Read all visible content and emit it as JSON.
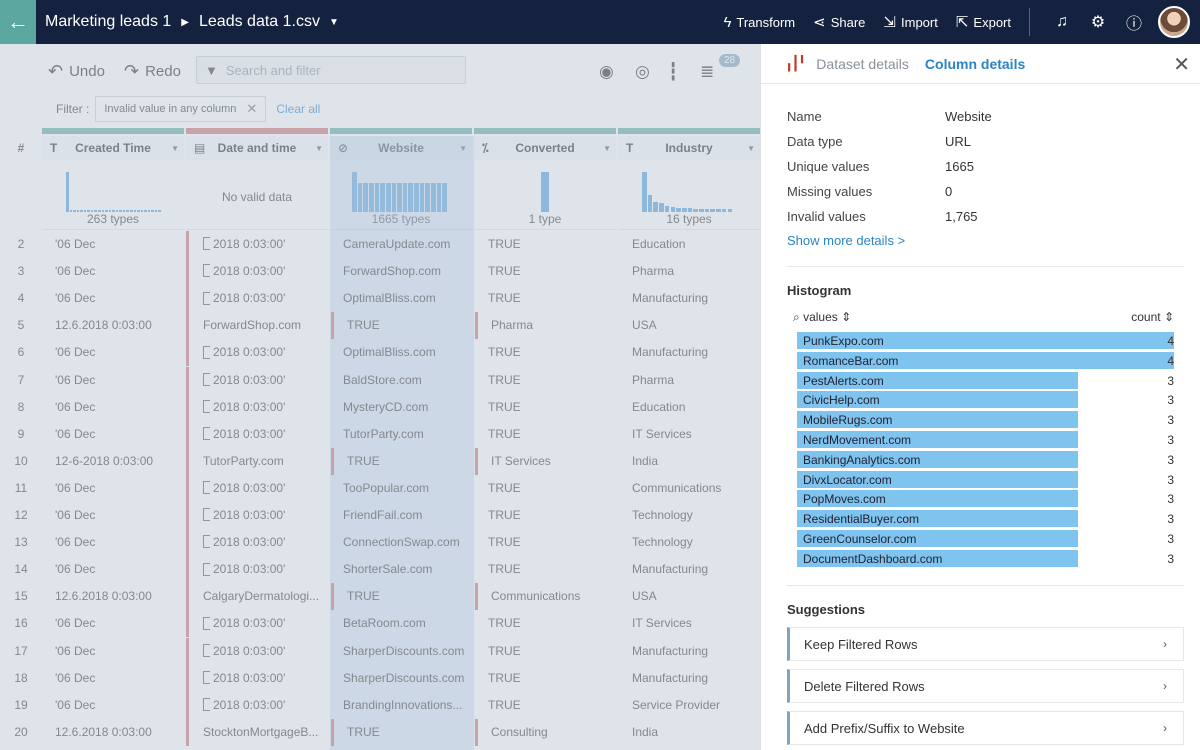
{
  "topbar": {
    "back_icon": "arrow-left-icon",
    "project": "Marketing leads 1",
    "dataset": "Leads data 1.csv",
    "actions": [
      {
        "icon": "bolt-icon",
        "label": "Transform"
      },
      {
        "icon": "share-icon",
        "label": "Share"
      },
      {
        "icon": "import-icon",
        "label": "Import"
      },
      {
        "icon": "export-icon",
        "label": "Export"
      }
    ],
    "icons": [
      "bell-icon",
      "gear-icon",
      "help-icon"
    ]
  },
  "toolbar": {
    "undo": "Undo",
    "redo": "Redo",
    "search_placeholder": "Search and filter",
    "badge": "28"
  },
  "filter": {
    "label": "Filter :",
    "chip": "Invalid value in any column",
    "clear": "Clear all"
  },
  "columns": [
    {
      "type_icon": "T",
      "name": "Created Time",
      "hist_caption": "263 types",
      "bars": [
        0.95,
        0.05,
        0.05,
        0.05,
        0.05,
        0.05,
        0.05,
        0.05,
        0.05,
        0.05,
        0.05,
        0.05,
        0.05,
        0.05,
        0.05,
        0.05,
        0.05,
        0.05,
        0.05,
        0.05,
        0.05,
        0.05,
        0.05,
        0.05,
        0.05,
        0.05,
        0.05
      ],
      "color": "#5ca7a0"
    },
    {
      "type_icon": "▤",
      "name": "Date and time",
      "hist_caption": "",
      "nodata": "No valid data",
      "bars": [],
      "color": "#c9706f"
    },
    {
      "type_icon": "⊘",
      "name": "Website",
      "hist_caption": "1665 types",
      "bars": [
        0.95,
        0.7,
        0.7,
        0.7,
        0.7,
        0.7,
        0.7,
        0.7,
        0.7,
        0.7,
        0.7,
        0.7,
        0.7,
        0.7,
        0.7,
        0.7,
        0.7
      ],
      "color": "#5ca7a0"
    },
    {
      "type_icon": "⁒",
      "name": "Converted",
      "hist_caption": "1 type",
      "bars": [
        0.95
      ],
      "color": "#5ca7a0"
    },
    {
      "type_icon": "T",
      "name": "Industry",
      "hist_caption": "16 types",
      "bars": [
        0.95,
        0.4,
        0.25,
        0.22,
        0.15,
        0.12,
        0.1,
        0.1,
        0.1,
        0.08,
        0.08,
        0.08,
        0.08,
        0.08,
        0.08,
        0.08
      ],
      "color": "#5ca7a0"
    }
  ],
  "rows": [
    {
      "n": "2",
      "c1": "'06 Dec",
      "c2": "2018 0:03:00'",
      "c2_tick": true,
      "c3": "CameraUpdate.com",
      "c4": "TRUE",
      "c5": "Education",
      "bad": false
    },
    {
      "n": "3",
      "c1": "'06 Dec",
      "c2": "2018 0:03:00'",
      "c2_tick": true,
      "c3": "ForwardShop.com",
      "c4": "TRUE",
      "c5": "Pharma",
      "bad": false
    },
    {
      "n": "4",
      "c1": "'06 Dec",
      "c2": "2018 0:03:00'",
      "c2_tick": true,
      "c3": "OptimalBliss.com",
      "c4": "TRUE",
      "c5": "Manufacturing",
      "bad": false
    },
    {
      "n": "5",
      "c1": "12.6.2018 0:03:00",
      "c2": "ForwardShop.com",
      "c2_tick": false,
      "c3": "TRUE",
      "c4": "Pharma",
      "c5": "USA",
      "bad": true
    },
    {
      "n": "6",
      "c1": "'06 Dec",
      "c2": "2018 0:03:00'",
      "c2_tick": true,
      "c3": "OptimalBliss.com",
      "c4": "TRUE",
      "c5": "Manufacturing",
      "bad": false
    },
    {
      "n": "7",
      "c1": "'06 Dec",
      "c2": "2018 0:03:00'",
      "c2_tick": true,
      "c3": "BaldStore.com",
      "c4": "TRUE",
      "c5": "Pharma",
      "bad": false
    },
    {
      "n": "8",
      "c1": "'06 Dec",
      "c2": "2018 0:03:00'",
      "c2_tick": true,
      "c3": "MysteryCD.com",
      "c4": "TRUE",
      "c5": "Education",
      "bad": false
    },
    {
      "n": "9",
      "c1": "'06 Dec",
      "c2": "2018 0:03:00'",
      "c2_tick": true,
      "c3": "TutorParty.com",
      "c4": "TRUE",
      "c5": "IT Services",
      "bad": false
    },
    {
      "n": "10",
      "c1": "12-6-2018 0:03:00",
      "c2": "TutorParty.com",
      "c2_tick": false,
      "c3": "TRUE",
      "c4": "IT Services",
      "c5": "India",
      "bad": true
    },
    {
      "n": "11",
      "c1": "'06 Dec",
      "c2": "2018 0:03:00'",
      "c2_tick": true,
      "c3": "TooPopular.com",
      "c4": "TRUE",
      "c5": "Communications",
      "bad": false
    },
    {
      "n": "12",
      "c1": "'06 Dec",
      "c2": "2018 0:03:00'",
      "c2_tick": true,
      "c3": "FriendFail.com",
      "c4": "TRUE",
      "c5": "Technology",
      "bad": false
    },
    {
      "n": "13",
      "c1": "'06 Dec",
      "c2": "2018 0:03:00'",
      "c2_tick": true,
      "c3": "ConnectionSwap.com",
      "c4": "TRUE",
      "c5": "Technology",
      "bad": false
    },
    {
      "n": "14",
      "c1": "'06 Dec",
      "c2": "2018 0:03:00'",
      "c2_tick": true,
      "c3": "ShorterSale.com",
      "c4": "TRUE",
      "c5": "Manufacturing",
      "bad": false
    },
    {
      "n": "15",
      "c1": "12.6.2018 0:03:00",
      "c2": "CalgaryDermatologi...",
      "c2_tick": false,
      "c3": "TRUE",
      "c4": "Communications",
      "c5": "USA",
      "bad": true
    },
    {
      "n": "16",
      "c1": "'06 Dec",
      "c2": "2018 0:03:00'",
      "c2_tick": true,
      "c3": "BetaRoom.com",
      "c4": "TRUE",
      "c5": "IT Services",
      "bad": false
    },
    {
      "n": "17",
      "c1": "'06 Dec",
      "c2": "2018 0:03:00'",
      "c2_tick": true,
      "c3": "SharperDiscounts.com",
      "c4": "TRUE",
      "c5": "Manufacturing",
      "bad": false
    },
    {
      "n": "18",
      "c1": "'06 Dec",
      "c2": "2018 0:03:00'",
      "c2_tick": true,
      "c3": "SharperDiscounts.com",
      "c4": "TRUE",
      "c5": "Manufacturing",
      "bad": false
    },
    {
      "n": "19",
      "c1": "'06 Dec",
      "c2": "2018 0:03:00'",
      "c2_tick": true,
      "c3": "BrandingInnovations...",
      "c4": "TRUE",
      "c5": "Service Provider",
      "bad": false
    },
    {
      "n": "20",
      "c1": "12.6.2018 0:03:00",
      "c2": "StocktonMortgageB...",
      "c2_tick": false,
      "c3": "TRUE",
      "c4": "Consulting",
      "c5": "India",
      "bad": true
    }
  ],
  "row_header": "#",
  "panel": {
    "tab_dataset": "Dataset details",
    "tab_column": "Column details",
    "details": [
      {
        "k": "Name",
        "v": "Website"
      },
      {
        "k": "Data type",
        "v": "URL"
      },
      {
        "k": "Unique values",
        "v": "1665"
      },
      {
        "k": "Missing values",
        "v": "0"
      },
      {
        "k": "Invalid values",
        "v": "1,765"
      }
    ],
    "show_more": "Show more details >",
    "histogram_title": "Histogram",
    "values_label": "values",
    "count_label": "count",
    "histogram": [
      {
        "name": "PunkExpo.com",
        "count": 4
      },
      {
        "name": "RomanceBar.com",
        "count": 4
      },
      {
        "name": "PestAlerts.com",
        "count": 3
      },
      {
        "name": "CivicHelp.com",
        "count": 3
      },
      {
        "name": "MobileRugs.com",
        "count": 3
      },
      {
        "name": "NerdMovement.com",
        "count": 3
      },
      {
        "name": "BankingAnalytics.com",
        "count": 3
      },
      {
        "name": "DivxLocator.com",
        "count": 3
      },
      {
        "name": "PopMoves.com",
        "count": 3
      },
      {
        "name": "ResidentialBuyer.com",
        "count": 3
      },
      {
        "name": "GreenCounselor.com",
        "count": 3
      },
      {
        "name": "DocumentDashboard.com",
        "count": 3
      }
    ],
    "suggestions_title": "Suggestions",
    "suggestions": [
      "Keep Filtered Rows",
      "Delete Filtered Rows",
      "Add Prefix/Suffix to Website"
    ]
  }
}
